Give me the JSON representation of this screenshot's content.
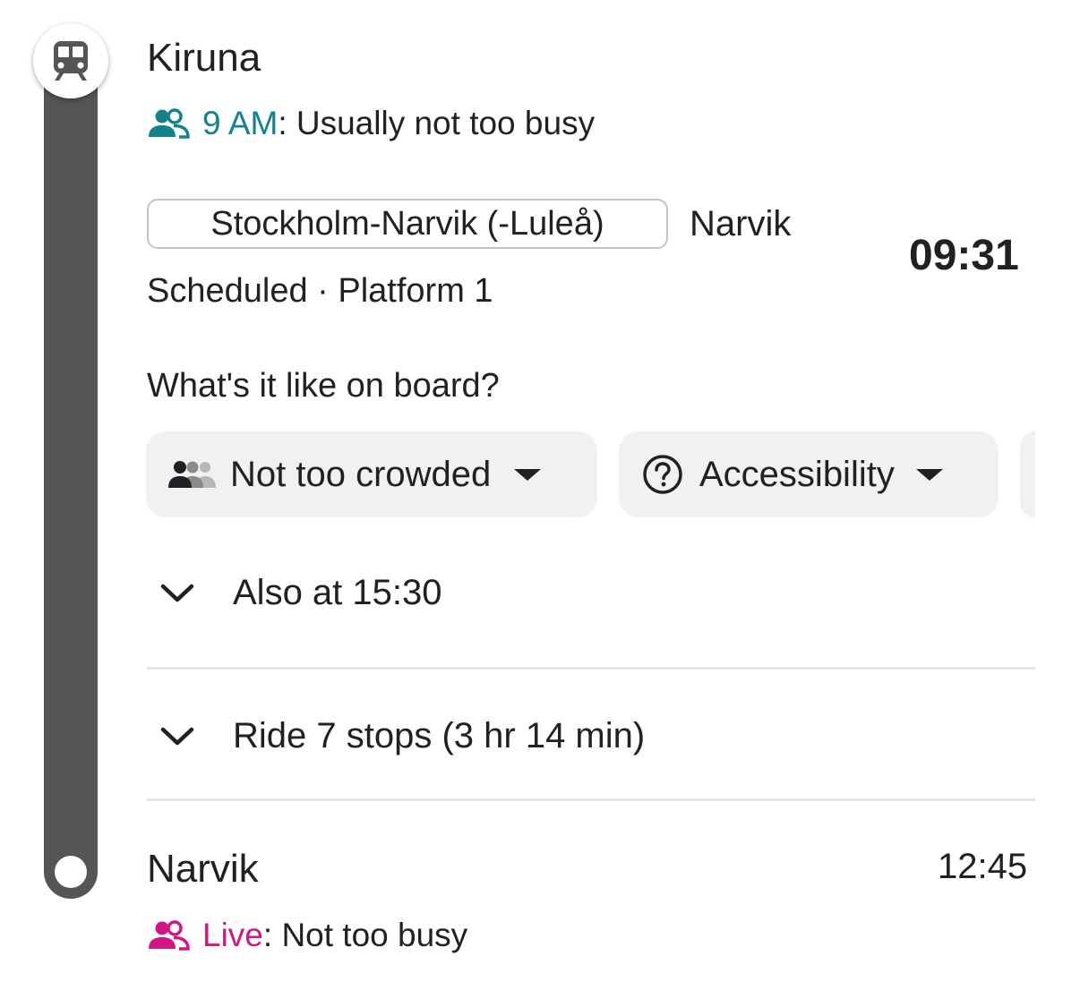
{
  "origin": {
    "name": "Kiruna",
    "busyness_time": "9 AM",
    "busyness_text": ": Usually not too busy",
    "transit_icon": "train-icon",
    "people_icon": "people-icon",
    "accent_color": "#12828c"
  },
  "departure": {
    "route_name": "Stockholm-Narvik (-Luleå)",
    "headsign": "Narvik",
    "time": "09:31",
    "status": "Scheduled",
    "separator": " · ",
    "platform": "Platform 1"
  },
  "onboard": {
    "question": "What's it like on board?",
    "chips": [
      {
        "label": "Not too crowded",
        "icon": "crowd-icon"
      },
      {
        "label": "Accessibility",
        "icon": "help-circle-icon"
      }
    ]
  },
  "expanders": {
    "also_at": "Also at 15:30",
    "ride": "Ride 7 stops (3 hr 14 min)",
    "chevron_icon": "chevron-down-icon"
  },
  "destination": {
    "name": "Narvik",
    "time": "12:45",
    "busyness_label": "Live",
    "busyness_text": ": Not too busy",
    "people_icon": "people-icon",
    "accent_color": "#d01884"
  },
  "timeline": {
    "bar_color": "#555555"
  }
}
